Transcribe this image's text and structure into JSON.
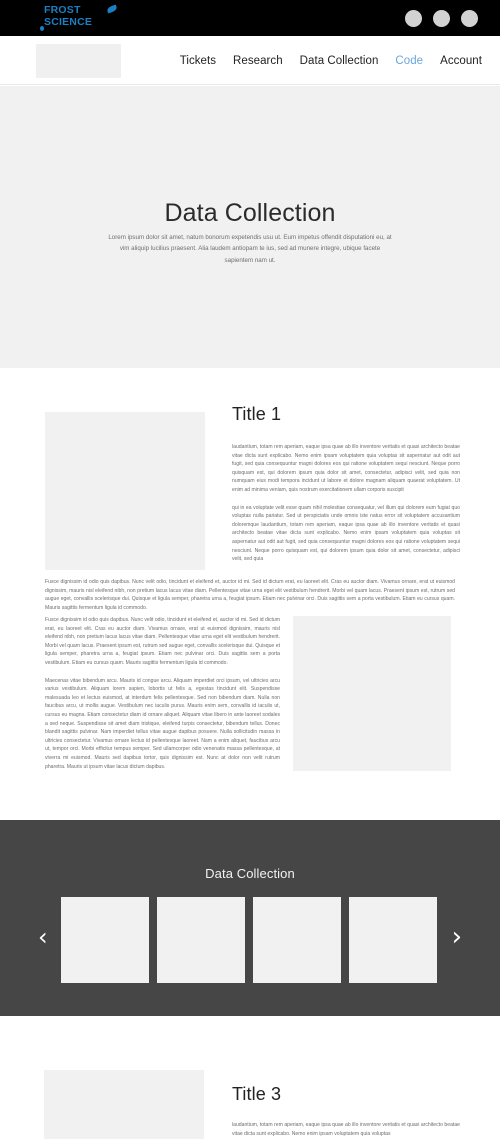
{
  "topbar": {
    "logo_line1": "FROST",
    "logo_line2": "SCIENCE",
    "buttons": [
      "circle-button-1",
      "circle-button-2",
      "circle-button-3"
    ]
  },
  "nav": {
    "items": [
      {
        "label": "Tickets",
        "active": false
      },
      {
        "label": "Research",
        "active": false
      },
      {
        "label": "Data Collection",
        "active": false
      },
      {
        "label": "Code",
        "active": true
      },
      {
        "label": "Account",
        "active": false
      }
    ],
    "active_color": "#6aa6dd"
  },
  "hero": {
    "title": "Data Collection",
    "subtitle": "Lorem ipsum dolor sit amet, natum bonorum expetendis usu ut. Eum impetus offendit disputationi eu, at vim aliquip lucilius praesent. Alia laudem antiopam te ius, sed ad munere integre, ubique facete sapientem nam ut.",
    "background": "#f1f1f1"
  },
  "section1": {
    "title": "Title 1",
    "paragraph1": "laudantium, totam rem aperiam, eaque ipsa quae ab illo inventore veritatis et quasi architecto beatae vitae dicta sunt explicabo. Nemo enim ipsam voluptatem quia voluptas sit aspernatur aut odit aut fugit, sed quia consequuntur magni dolores eos qui ratione voluptatem sequi nesciunt. Neque porro quisquam est, qui dolorem ipsum quia dolor sit amet, consectetur, adipisci velit, sed quia non numquam eius modi tempora incidunt ut labore et dolore magnam aliquam quaerat voluptatem. Ut enim ad minima veniam, quis nostrum exercitationem ullam corporis suscipit",
    "paragraph2": "qui in ea voluptate velit esse quam nihil molestiae consequatur, vel illum qui dolorem eum fugiat quo voluptas nulla pariatur. Sed ut perspiciatis unde omnis iste natus error sit voluptatem accusantium doloremque laudantium, totam rem aperiam, eaque ipsa quae ab illo inventore veritatis et quasi architecto beatae vitae dicta sunt explicabo. Nemo enim ipsam voluptatem quia voluptas sit aspernatur aut odit aut fugit, sed quia consequuntur magni dolores eos qui ratione voluptatem sequi nesciunt. Neque porro quisquam est, qui dolorem ipsum quia dolor sit amet, consectetur, adipisci velit, sed quia",
    "wide_paragraph": "Fusce dignissim id odio quis dapibus. Nunc velit odio, tincidunt et eleifend et, auctor id mi. Sed id dictum erat, eu laoreet elit. Cras eu auctor diam. Vivamus ornare, erat ut euismod dignissim, mauris nisl eleifend nibh, non pretium lacus lacus vitae diam. Pellentesque vitae urna eget elit vestibulum hendrerit. Morbi vel quam lacus. Praesent ipsum est, rutrum sed augue eget, convallis scelerisque dui. Quisque et ligula semper, pharetra urna a, feugiat ipsum. Etiam nec pulvinar orci. Duis sagittis sem a porta vestibulum. Etiam eu cursus quam. Mauris sagittis fermentum ligula id commodo.",
    "column_paragraph1": "Fusce dignissim id odio quis dapibus. Nunc velit odio, tincidunt et eleifend et, auctor id mi. Sed id dictum erat, eu laoreet elit. Cras eu auctor diam. Vivamus ornare, erat ut euismod dignissim, mauris nisl eleifend nibh, non pretium lacus lacus vitae diam. Pellentesque vitae urna eget elit vestibulum hendrerit. Morbi vel quam lacus. Praesent ipsum est, rutrum sed augue eget, convallis scelerisque dui. Quisque et ligula semper, pharetra urna a, feugiat ipsum. Etiam nec pulvinar orci. Duis sagittis sem a porta vestibulum. Etiam eu cursus quam. Mauris sagittis fermentum ligula id commodo.",
    "column_paragraph2": "Maecenas vitae bibendum arcu. Mauris id congue arcu. Aliquam imperdiet orci ipsum, vel ultricies arcu varius vestibulum. Aliquam lorem sapien, lobortis ut felis a, egestas tincidunt elit. Suspendisse malesuada leo et lectus euismod, at interdum felis pellentesque. Sed non bibendum diam. Nulla non faucibus arcu, ut mollis augue. Vestibulum nec iaculis purus. Mauris enim sem, convallis id iaculis ut, cursus eu magna. Etiam consectetur diam id ornare aliquet. Aliquam vitae libero in ante laoreet sodales a sed neque. Suspendisse sit amet diam tristique, eleifend turpis consectetur, bibendum tellus. Donec blandit sagittis pulvinar. Nam imperdiet tellus vitae augue dapibus posuere. Nulla sollicitudin massa in ultricies consectetur. Vivamus ornare lectus id pellentesque laoreet. Nam a enim aliquet, faucibus arcu ut, tempor orci. Morbi efficitur tempus semper. Sed ullamcorper odio venenatis massa pellentesque, at viverra mi euismod. Mauris sed dapibus tortor, quis dignissim est. Nunc at dolor non velit rutrum pharetra. Mauris ut ipsum vitae lacus dictum dapibus."
  },
  "carousel": {
    "title": "Data Collection",
    "prev_icon": "‹",
    "next_icon": "›",
    "cards": [
      "card-1",
      "card-2",
      "card-3",
      "card-4"
    ],
    "background": "#464646"
  },
  "section3": {
    "title": "Title 3",
    "paragraph1": "laudantium, totam rem aperiam, eaque ipsa quae ab illo inventore veritatis et quasi architecto beatae vitae dicta sunt explicabo. Nemo enim ipsam voluptatem quia voluptas"
  }
}
